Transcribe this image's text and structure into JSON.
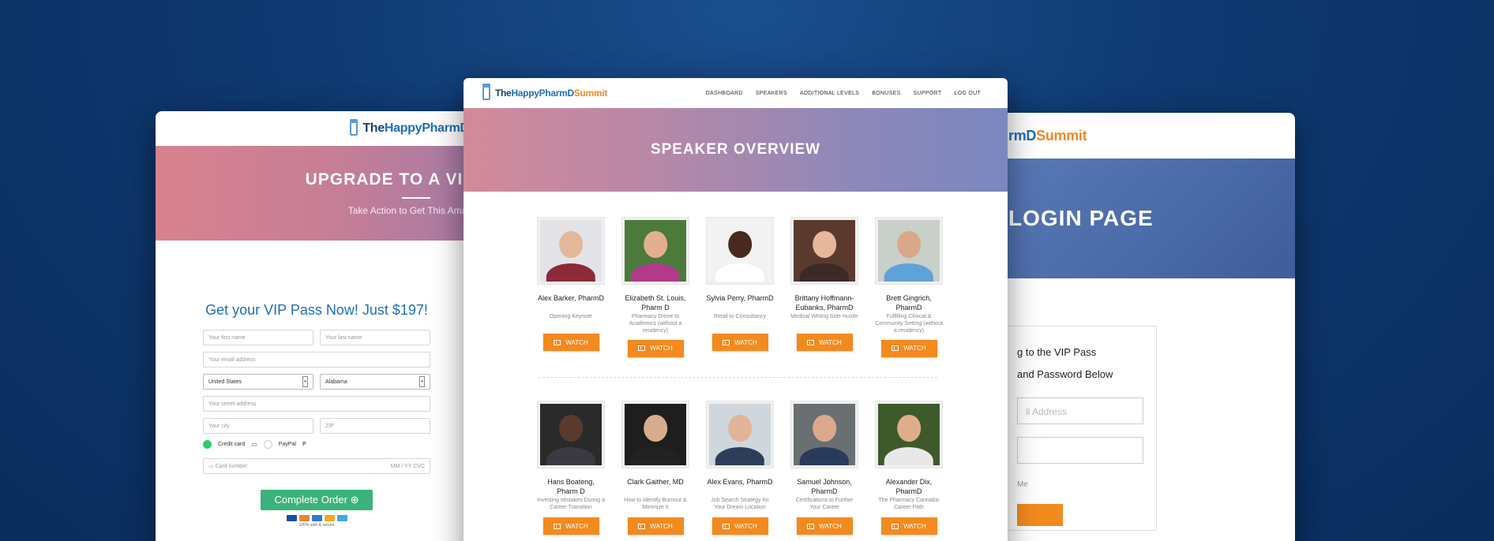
{
  "brand": {
    "the": "The",
    "happy": "HappyPharmD",
    "summit": "Summit"
  },
  "left": {
    "hero_title": "UPGRADE TO A VIP PASS",
    "hero_sub": "Take Action to Get This Amazing",
    "form_title": "Get your VIP Pass Now! Just $197!",
    "first_name": "Your first name",
    "last_name": "Your last name",
    "email": "Your email address",
    "country": "United States",
    "state": "Alabama",
    "street": "Your street address",
    "city": "Your city",
    "zip": "ZIP",
    "credit_card": "Credit card",
    "paypal": "PayPal",
    "card_number": "Card number",
    "card_exp": "MM / YY  CVC",
    "complete_btn": "Complete Order",
    "secure": "100% safe & secure"
  },
  "right": {
    "hero_title": "LOGIN PAGE",
    "brand_partial": "rmD",
    "summit": "Summit",
    "line1": "g to the VIP Pass",
    "line2": "and Password Below",
    "email_placeholder": "il Address",
    "password_placeholder": "",
    "remember": "Me"
  },
  "center": {
    "nav": [
      "DASHBOARD",
      "SPEAKERS",
      "ADDITIONAL LEVELS",
      "BONUSES",
      "SUPPORT",
      "LOG OUT"
    ],
    "hero_title": "SPEAKER OVERVIEW",
    "watch_label": "WATCH",
    "speakers_row1": [
      {
        "name": "Alex Barker, PharmD",
        "topic": "Opening Keynote"
      },
      {
        "name": "Elizabeth St. Louis, Pharm D",
        "topic": "Pharmacy Drone to Academics (without a residency)"
      },
      {
        "name": "Sylvia Perry, PharmD",
        "topic": "Retail to Consultancy"
      },
      {
        "name": "Brittany Hoffmann-Eubanks, PharmD",
        "topic": "Medical Writing Side Hustle"
      },
      {
        "name": "Brett Gingrich, PharmD",
        "topic": "Fulfilling Clinical & Community Setting (without a residency)"
      }
    ],
    "speakers_row2": [
      {
        "name": "Hans Boateng, Pharm D",
        "topic": "Investing Mistakes During a Career Transition"
      },
      {
        "name": "Clark Gaither, MD",
        "topic": "How to Identify Burnout & Minimize It"
      },
      {
        "name": "Alex Evans, PharmD",
        "topic": "Job Search Strategy for Your Dream Location"
      },
      {
        "name": "Samuel Johnson, PharmD",
        "topic": "Certifications to Further Your Career"
      },
      {
        "name": "Alexander Dix, PharmD",
        "topic": "The Pharmacy Cannabis Career Path"
      }
    ]
  }
}
